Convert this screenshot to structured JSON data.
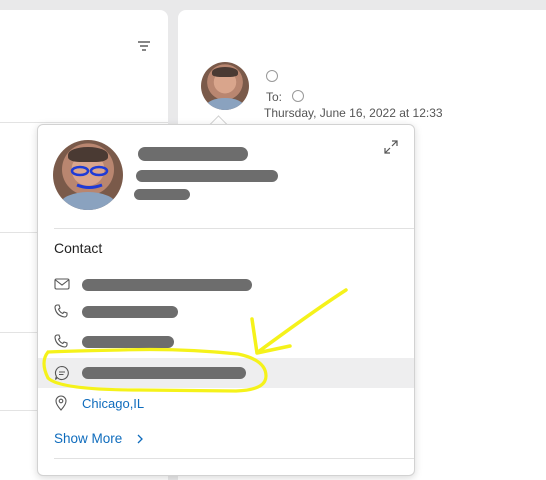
{
  "message": {
    "to_label": "To:",
    "date": "Thursday, June 16, 2022 at 12:33"
  },
  "contact_card": {
    "section_title": "Contact",
    "location": "Chicago,IL",
    "show_more": "Show More"
  },
  "icons": {
    "filter": "filter-icon",
    "expand": "expand-icon",
    "email": "mail-icon",
    "phone": "phone-icon",
    "chat": "chat-icon",
    "location": "location-pin-icon",
    "chevron": "chevron-right-icon"
  },
  "colors": {
    "link": "#0f6cbd",
    "highlight_annotation": "#f5f21a",
    "redaction": "#6d6d6d"
  }
}
